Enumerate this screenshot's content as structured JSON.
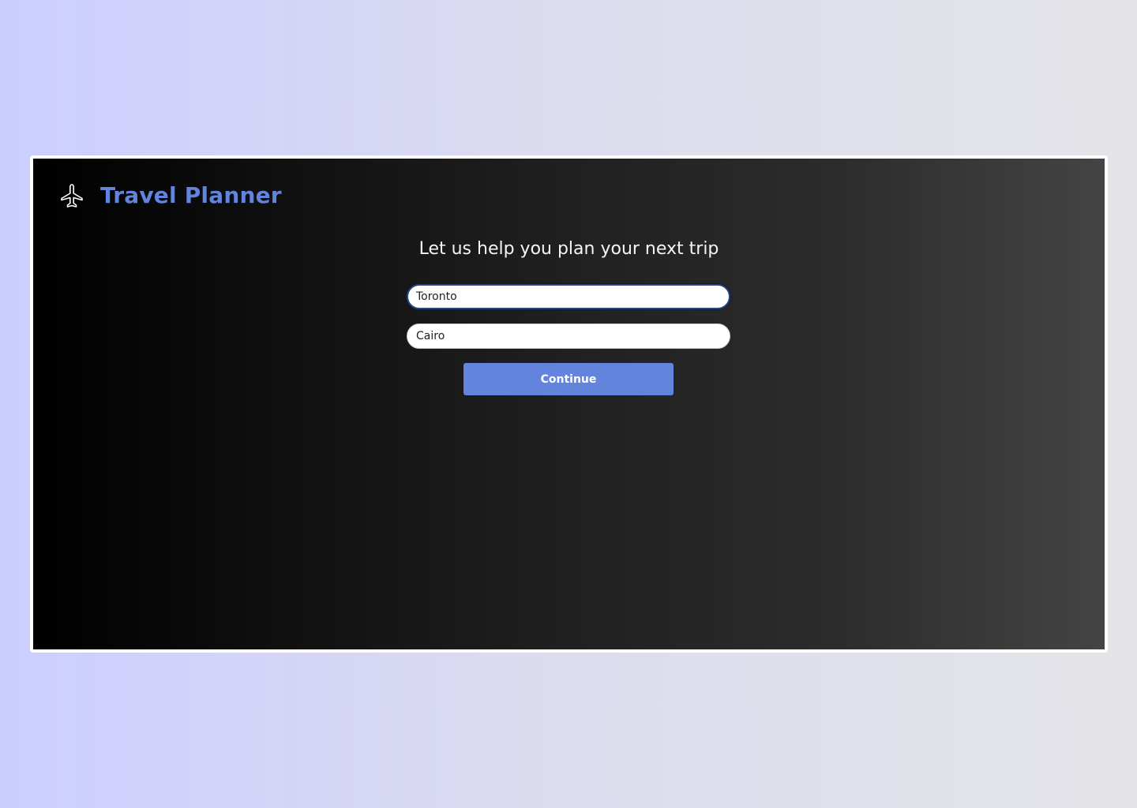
{
  "app": {
    "title": "Travel Planner",
    "icon": "airplane-icon"
  },
  "main": {
    "heading": "Let us help you plan your next trip",
    "origin_value": "Toronto",
    "destination_value": "Cairo",
    "continue_label": "Continue"
  },
  "colors": {
    "accent": "#6284dc",
    "page_background_start": "#ccceff",
    "page_background_end": "#e4e4e8",
    "card_background_start": "#000000",
    "card_background_end": "#444444",
    "focus_ring": "#26457e"
  }
}
